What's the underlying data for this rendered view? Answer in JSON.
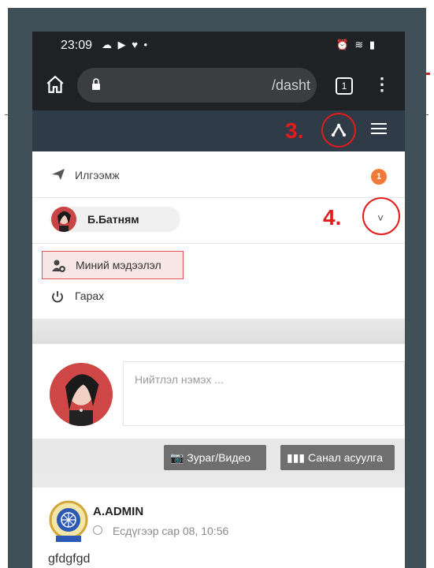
{
  "status_bar": {
    "time": "23:09",
    "icons": "☁ ▶ ♥ •",
    "right_icons": "⏰ ≋ ▮"
  },
  "browser": {
    "url": "/dasht",
    "tab_count": "1",
    "menu": "⋮"
  },
  "appbar": {
    "step3_label": "3.",
    "step4_label": "4."
  },
  "menu": {
    "messages_label": "Илгээмж",
    "messages_badge": "1",
    "user_name": "Б.Батням",
    "profile_label": "Миний мэдээлэл",
    "logout_label": "Гарах",
    "chevron": "˅"
  },
  "composer": {
    "placeholder": "Нийтлэл нэмэх ...",
    "photo_button": "Зураг/Видео",
    "poll_button": "Санал асуулга"
  },
  "feed": {
    "author": "A.ADMIN",
    "time": "Есдүгээр сар 08, 10:56",
    "content": "gfdgfgd"
  },
  "colors": {
    "accent_red": "#e31b1b",
    "appbar": "#2f3b46",
    "badge": "#f07a3a"
  }
}
